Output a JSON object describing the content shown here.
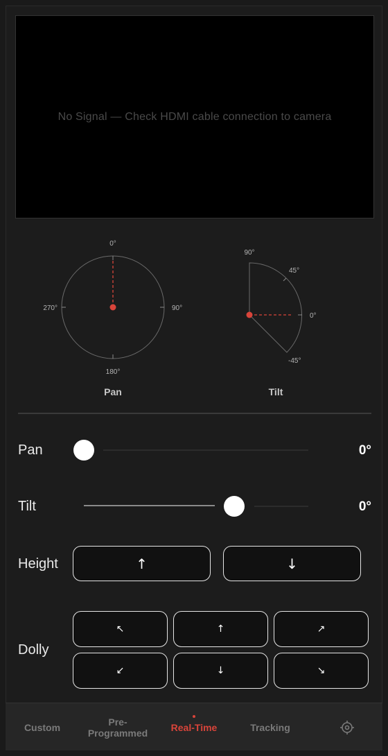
{
  "video": {
    "message": "No Signal — Check HDMI cable connection to camera"
  },
  "pan_dial": {
    "label": "Pan",
    "ticks": {
      "top": "0°",
      "right": "90°",
      "bottom": "180°",
      "left": "270°"
    },
    "angle": 0,
    "accent": "#d9443a"
  },
  "tilt_dial": {
    "label": "Tilt",
    "ticks": {
      "t90": "90°",
      "t45": "45°",
      "t0": "0°",
      "tm45": "-45°"
    },
    "angle": 0
  },
  "controls": {
    "pan": {
      "label": "Pan",
      "value": "0°",
      "slider_fraction": 0.0
    },
    "tilt": {
      "label": "Tilt",
      "value": "0°",
      "slider_fraction": 0.67
    },
    "height": {
      "label": "Height",
      "up": "↑",
      "down": "↓"
    },
    "dolly": {
      "label": "Dolly",
      "buttons": [
        "↖",
        "↑",
        "↗",
        "↙",
        "↓",
        "↘"
      ]
    }
  },
  "tabs": [
    {
      "label": "Custom",
      "active": false
    },
    {
      "label": "Pre-\nProgrammed",
      "active": false
    },
    {
      "label": "Real-Time",
      "active": true
    },
    {
      "label": "Tracking",
      "active": false
    },
    {
      "icon": "settings-gear-icon",
      "active": false
    }
  ],
  "colors": {
    "accent": "#d9443a",
    "background": "#1c1c1c",
    "button_border": "#e6e6e6"
  }
}
